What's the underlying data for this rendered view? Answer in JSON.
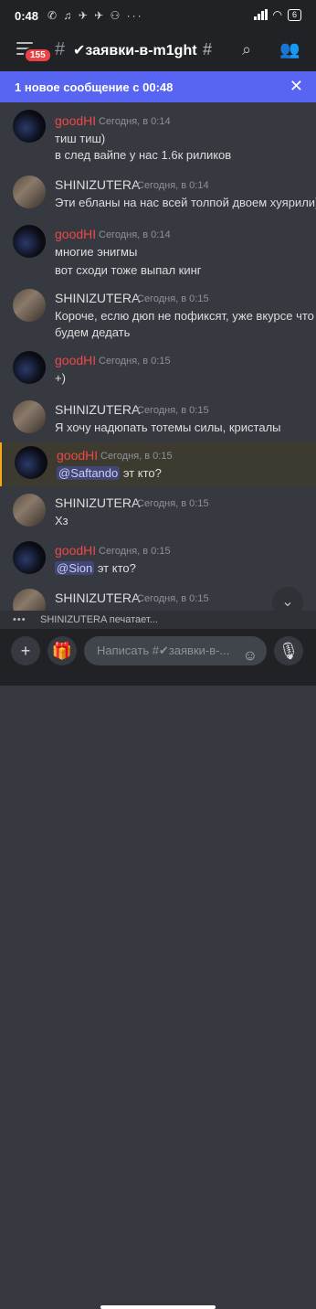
{
  "status": {
    "time": "0:48",
    "battery": "6",
    "icons": "✆ ♫ ✈ ✈ ⚇ ···"
  },
  "header": {
    "title": "✔заявки-в-m1ght",
    "badge": "155"
  },
  "banner": {
    "text": "1 новое сообщение с 00:48"
  },
  "messages": [
    {
      "user": "goodHI",
      "time": "Сегодня, в 0:14",
      "lines": [
        "тиш тиш)",
        "в след вайпе у нас 1.6к риликов"
      ]
    },
    {
      "user": "SHINIZUTERA",
      "time": "Сегодня, в 0:14",
      "lines": [
        "Эти ебланы на нас всей толпой двоем хуярили)"
      ]
    },
    {
      "user": "goodHI",
      "time": "Сегодня, в 0:14",
      "lines": [
        "многие энигмы",
        "вот сходи тоже выпал кинг"
      ]
    },
    {
      "user": "SHINIZUTERA",
      "time": "Сегодня, в 0:15",
      "lines": [
        "Короче, еслю дюп не пофиксят, уже вкурсе что",
        "будем дедать"
      ]
    },
    {
      "user": "goodHI",
      "time": "Сегодня, в 0:15",
      "lines": [
        "+)"
      ]
    },
    {
      "user": "SHINIZUTERA",
      "time": "Сегодня, в 0:15",
      "lines": [
        "Я хочу надюпать тотемы силы, кристалы"
      ]
    },
    {
      "user": "goodHI",
      "time": "Сегодня, в 0:15",
      "mention": "@Saftando",
      "after": " эт кто?"
    },
    {
      "user": "SHINIZUTERA",
      "time": "Сегодня, в 0:15",
      "lines": [
        "Хз"
      ]
    },
    {
      "user": "goodHI",
      "time": "Сегодня, в 0:15",
      "mention": "@Sion",
      "after": " эт кто?"
    },
    {
      "user": "SHINIZUTERA",
      "time": "Сегодня, в 0:15"
    }
  ],
  "typing": {
    "text": "SHINIZUTERA печатает..."
  },
  "composer": {
    "placeholder": "Написать #✔заявки-в-..."
  }
}
